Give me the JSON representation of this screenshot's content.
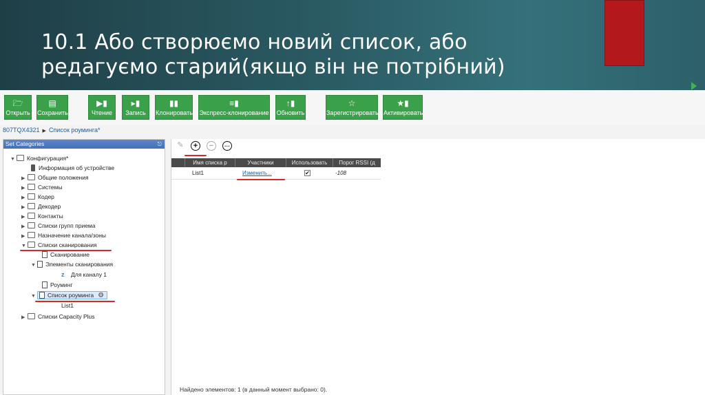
{
  "slide": {
    "title_line1": "10.1 Або створюємо новий список, або",
    "title_line2": "редагуємо старий(якщо він не потрібний)",
    "accent_color": "#b3191c",
    "header_color": "#2a5a63"
  },
  "toolbar": {
    "open": "Открыть",
    "save": "Сохранить",
    "read": "Чтение",
    "write": "Запись",
    "clone": "Клонировать",
    "express_clone": "Экспресс-клонирование",
    "update": "Обновить",
    "register": "Зарегистрировать",
    "activate": "Активировать",
    "button_color": "#3aa14a"
  },
  "breadcrumb": {
    "device": "807TQX4321",
    "current": "Список роуминга*"
  },
  "left_panel": {
    "title": "Set Categories",
    "tree": {
      "root": "Конфигурация*",
      "device_info": "Информация об устройстве",
      "general": "Общие положения",
      "systems": "Системы",
      "coder": "Кодер",
      "decoder": "Декодер",
      "contacts": "Контакты",
      "rx_groups": "Списки групп приема",
      "channel_zone": "Назначение канала/зоны",
      "scan_lists": "Списки сканирования",
      "scan": "Сканирование",
      "scan_elements": "Элементы сканирования",
      "for_channel": "Для каналу 1",
      "roaming": "Роуминг",
      "roaming_list": "Список роуминга",
      "list1": "List1",
      "capacity_plus": "Списки Capacity Plus"
    }
  },
  "grid": {
    "columns": [
      "Имя списка р",
      "Участники",
      "Использовать",
      "Порог RSSI (д"
    ],
    "row": {
      "name": "List1",
      "members": "Изменить...",
      "use": "✔",
      "rssi": "-108"
    },
    "status": "Найдено элементов: 1 (в данный момент выбрано: 0)."
  }
}
